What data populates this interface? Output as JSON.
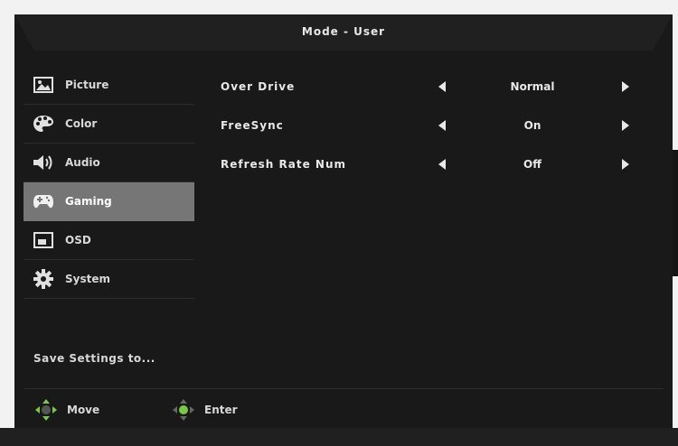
{
  "header": {
    "title": "Mode  -  User"
  },
  "sidebar": {
    "items": [
      {
        "label": "Picture",
        "icon": "picture-icon",
        "active": false
      },
      {
        "label": "Color",
        "icon": "palette-icon",
        "active": false
      },
      {
        "label": "Audio",
        "icon": "speaker-icon",
        "active": false
      },
      {
        "label": "Gaming",
        "icon": "gamepad-icon",
        "active": true
      },
      {
        "label": "OSD",
        "icon": "osd-icon",
        "active": false
      },
      {
        "label": "System",
        "icon": "gear-icon",
        "active": false
      }
    ],
    "save_label": "Save  Settings  to..."
  },
  "settings": [
    {
      "label": "Over  Drive",
      "value": "Normal"
    },
    {
      "label": "FreeSync",
      "value": "On"
    },
    {
      "label": "Refresh  Rate  Num",
      "value": "Off"
    }
  ],
  "footer": {
    "move_label": "Move",
    "enter_label": "Enter"
  },
  "colors": {
    "background": "#191919",
    "active_item": "#767676",
    "accent_green": "#7ac943"
  }
}
